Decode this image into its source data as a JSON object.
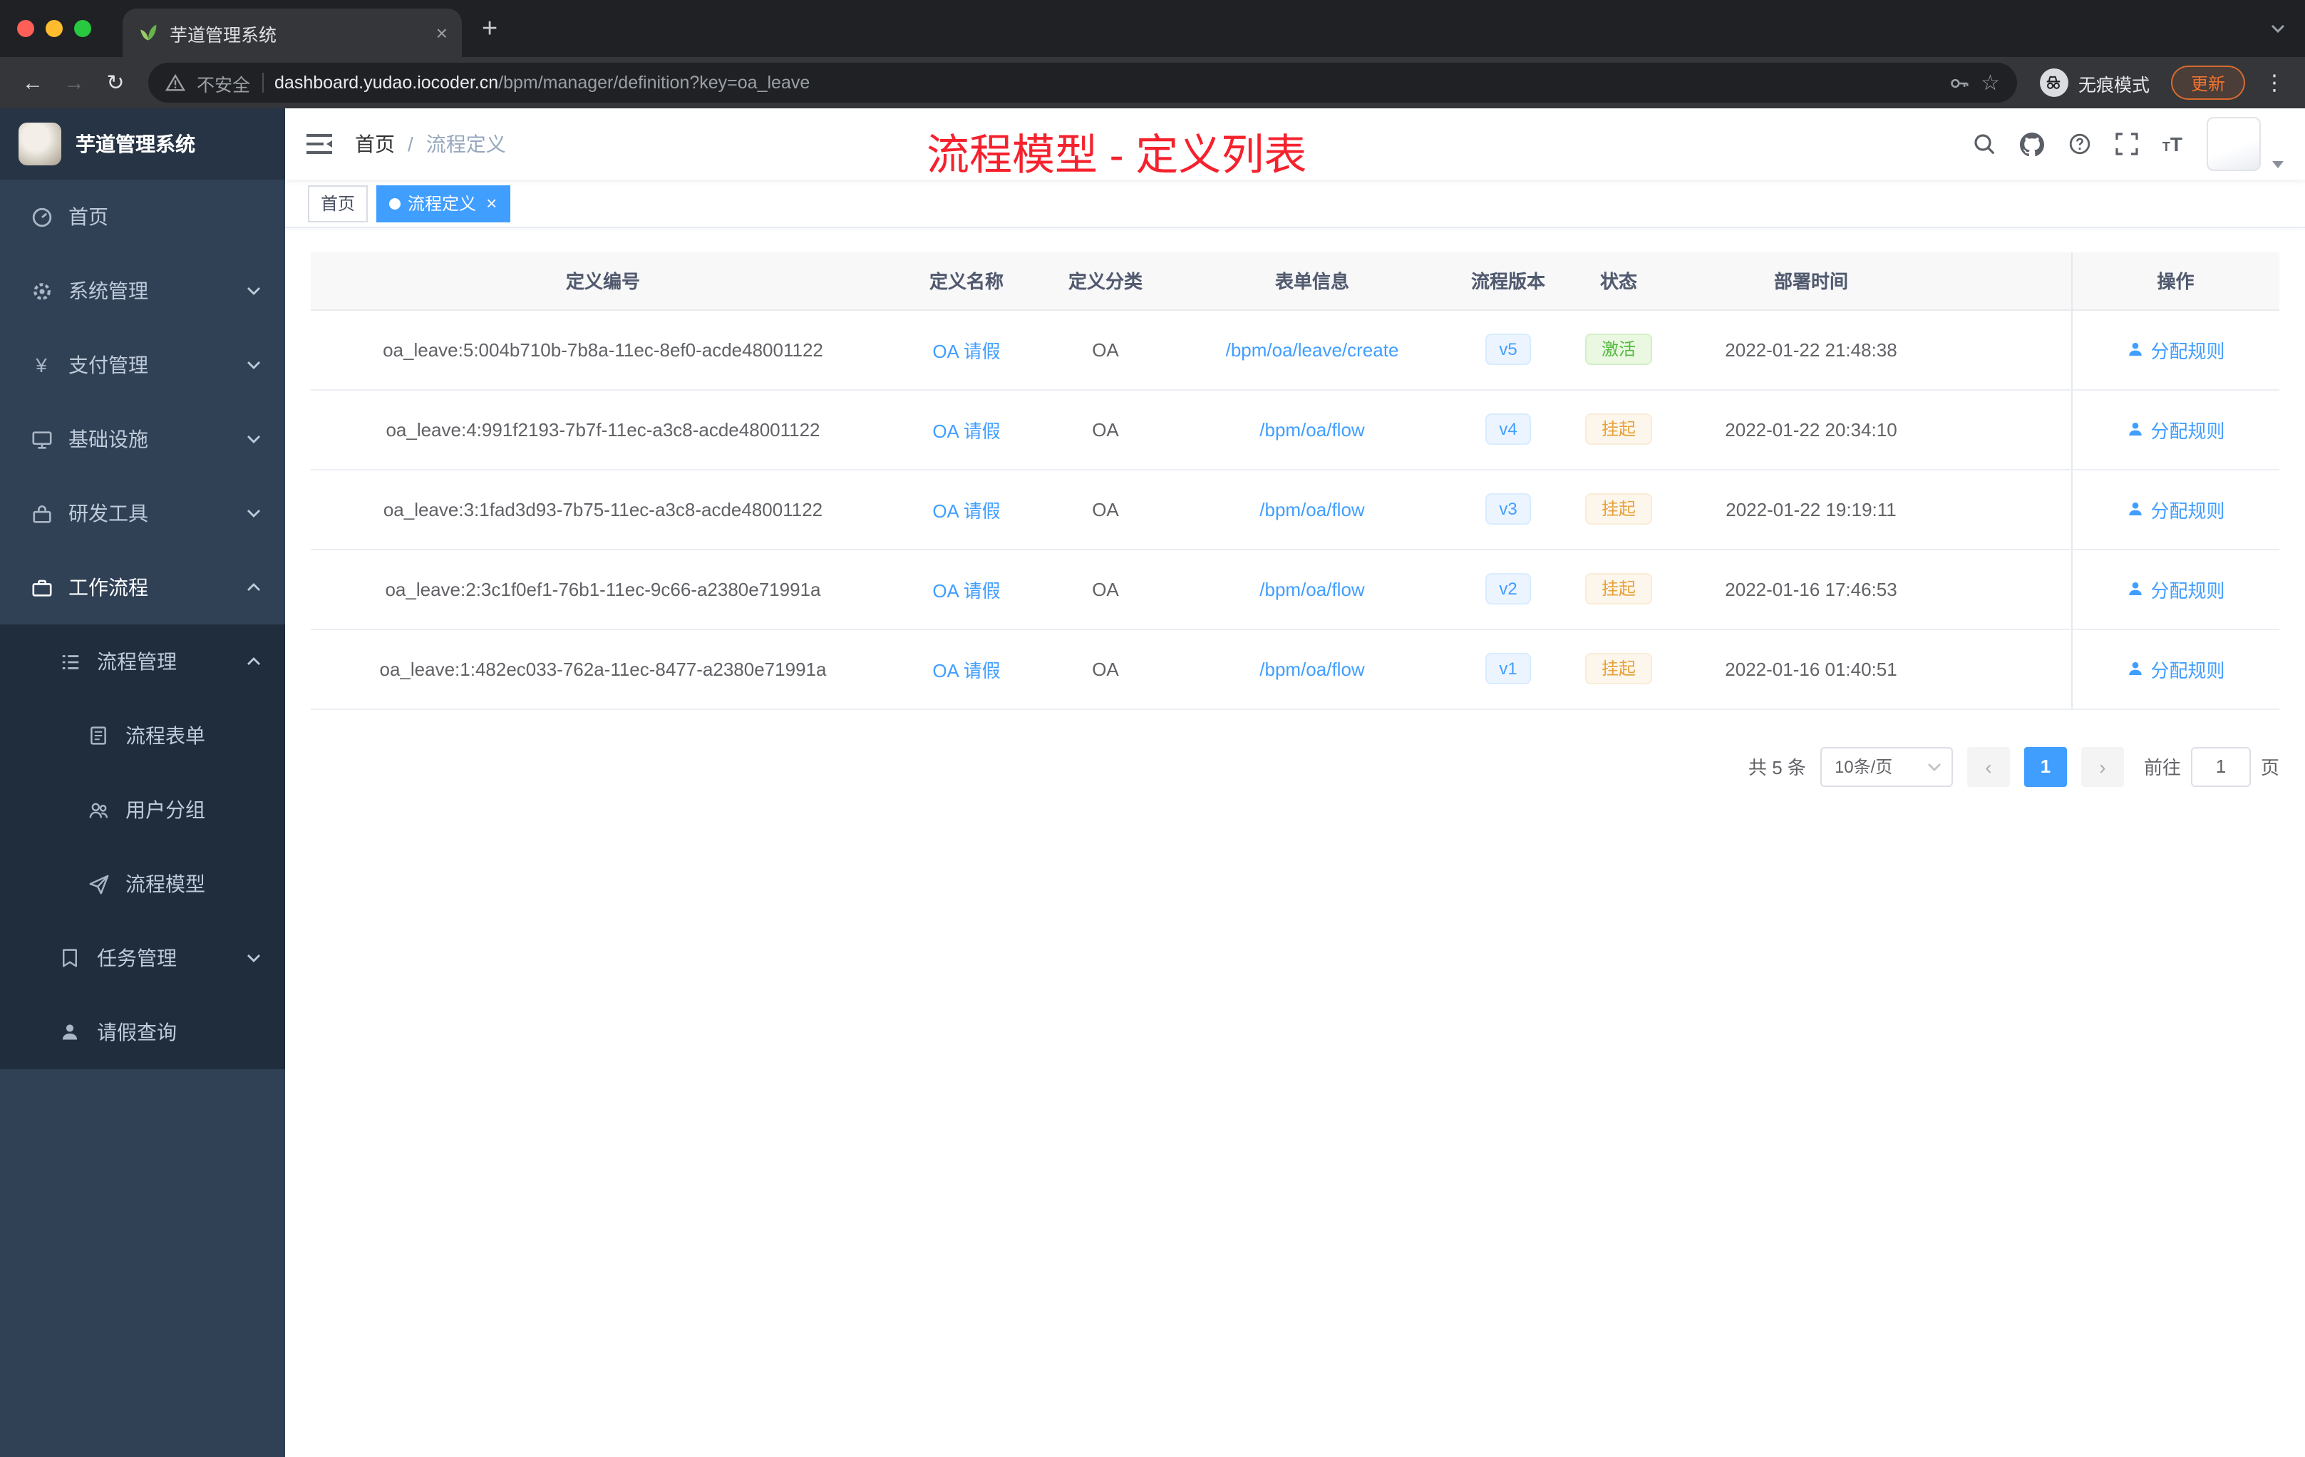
{
  "colors": {
    "primary": "#409eff",
    "success": "#67c23a",
    "warning": "#e6a23c",
    "annotation_red": "#f5222d",
    "sidebar_bg": "#304156",
    "sidebar_submenu_bg": "#1f2d3d",
    "chrome_dark": "#202124"
  },
  "icons": {
    "close": "×",
    "plus": "+",
    "back": "←",
    "forward": "→",
    "reload": "↻",
    "star": "☆",
    "kebab": "⋮",
    "yen": "¥",
    "prev": "‹",
    "next": "›"
  },
  "browser": {
    "tab_title": "芋道管理系统",
    "security_label": "不安全",
    "url_host": "dashboard.yudao.iocoder.cn",
    "url_path": "/bpm/manager/definition?key=oa_leave",
    "incognito_label": "无痕模式",
    "update_label": "更新"
  },
  "sidebar": {
    "logo_title": "芋道管理系统",
    "items": [
      {
        "label": "首页",
        "icon": "dashboard-icon"
      },
      {
        "label": "系统管理",
        "icon": "gear-icon",
        "arrow": "down"
      },
      {
        "label": "支付管理",
        "icon": "yen-icon",
        "arrow": "down"
      },
      {
        "label": "基础设施",
        "icon": "infrastructure-icon",
        "arrow": "down"
      },
      {
        "label": "研发工具",
        "icon": "tools-icon",
        "arrow": "down"
      },
      {
        "label": "工作流程",
        "icon": "workflow-icon",
        "arrow": "up",
        "active": true
      },
      {
        "label": "流程管理",
        "icon": "process-list-icon",
        "arrow": "up"
      },
      {
        "label": "流程表单",
        "icon": "form-icon"
      },
      {
        "label": "用户分组",
        "icon": "user-group-icon"
      },
      {
        "label": "流程模型",
        "icon": "paper-plane-icon"
      },
      {
        "label": "任务管理",
        "icon": "task-icon",
        "arrow": "down"
      },
      {
        "label": "请假查询",
        "icon": "person-icon"
      }
    ]
  },
  "header": {
    "breadcrumb_home": "首页",
    "breadcrumb_sep": "/",
    "breadcrumb_current": "流程定义",
    "annotation": "流程模型 - 定义列表"
  },
  "tags": {
    "home": "首页",
    "current": "流程定义"
  },
  "table": {
    "columns": [
      "定义编号",
      "定义名称",
      "定义分类",
      "表单信息",
      "流程版本",
      "状态",
      "部署时间",
      "操作"
    ],
    "rows": [
      {
        "id": "oa_leave:5:004b710b-7b8a-11ec-8ef0-acde48001122",
        "name": "OA 请假",
        "category": "OA",
        "form": "/bpm/oa/leave/create",
        "version": "v5",
        "status": "激活",
        "status_type": "success",
        "deploy_time": "2022-01-22 21:48:38",
        "action": "分配规则"
      },
      {
        "id": "oa_leave:4:991f2193-7b7f-11ec-a3c8-acde48001122",
        "name": "OA 请假",
        "category": "OA",
        "form": "/bpm/oa/flow",
        "version": "v4",
        "status": "挂起",
        "status_type": "warning",
        "deploy_time": "2022-01-22 20:34:10",
        "action": "分配规则"
      },
      {
        "id": "oa_leave:3:1fad3d93-7b75-11ec-a3c8-acde48001122",
        "name": "OA 请假",
        "category": "OA",
        "form": "/bpm/oa/flow",
        "version": "v3",
        "status": "挂起",
        "status_type": "warning",
        "deploy_time": "2022-01-22 19:19:11",
        "action": "分配规则"
      },
      {
        "id": "oa_leave:2:3c1f0ef1-76b1-11ec-9c66-a2380e71991a",
        "name": "OA 请假",
        "category": "OA",
        "form": "/bpm/oa/flow",
        "version": "v2",
        "status": "挂起",
        "status_type": "warning",
        "deploy_time": "2022-01-16 17:46:53",
        "action": "分配规则"
      },
      {
        "id": "oa_leave:1:482ec033-762a-11ec-8477-a2380e71991a",
        "name": "OA 请假",
        "category": "OA",
        "form": "/bpm/oa/flow",
        "version": "v1",
        "status": "挂起",
        "status_type": "warning",
        "deploy_time": "2022-01-16 01:40:51",
        "action": "分配规则"
      }
    ]
  },
  "pagination": {
    "total": "共 5 条",
    "page_size": "10条/页",
    "current_page": "1",
    "goto_prefix": "前往",
    "goto_value": "1",
    "goto_suffix": "页"
  }
}
